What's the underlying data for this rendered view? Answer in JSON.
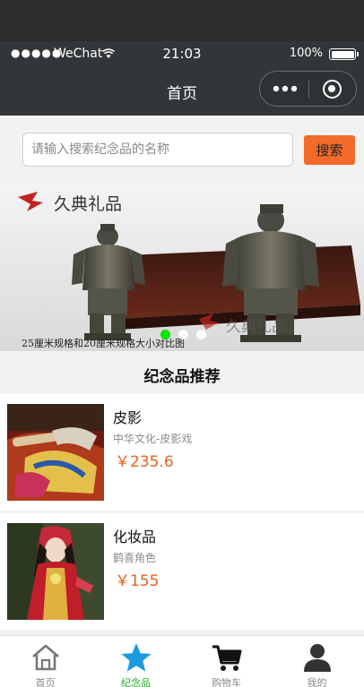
{
  "status_bar": {
    "signal": "●●●●●",
    "carrier": "WeChat",
    "time": "21:03",
    "battery": "100%"
  },
  "nav": {
    "title": "首页"
  },
  "search": {
    "placeholder": "请输入搜索纪念品的名称",
    "button_label": "搜索"
  },
  "banner": {
    "brand": "久典礼品",
    "caption": "25厘米规格和20厘米规格大小对比图",
    "active_index": 0,
    "slide_count": 3,
    "colors": {
      "active_dot": "#00e600",
      "inactive_dot": "#ffffff"
    }
  },
  "section": {
    "title": "纪念品推荐"
  },
  "products": [
    {
      "name": "皮影",
      "desc": "中华文化-皮影戏",
      "price": "￥235.6"
    },
    {
      "name": "化妆品",
      "desc": "鹤喜角色",
      "price": "￥155"
    }
  ],
  "tabs": [
    {
      "label": "首页",
      "icon": "home-icon",
      "active": false
    },
    {
      "label": "纪念品",
      "icon": "star-icon",
      "active": true
    },
    {
      "label": "购物车",
      "icon": "cart-icon",
      "active": false
    },
    {
      "label": "我的",
      "icon": "user-icon",
      "active": false
    }
  ],
  "colors": {
    "accent": "#f26b2a",
    "price": "#e8611f",
    "tab_active": "#1aad19",
    "star": "#1a9be0",
    "nav_bg": "#333638"
  }
}
